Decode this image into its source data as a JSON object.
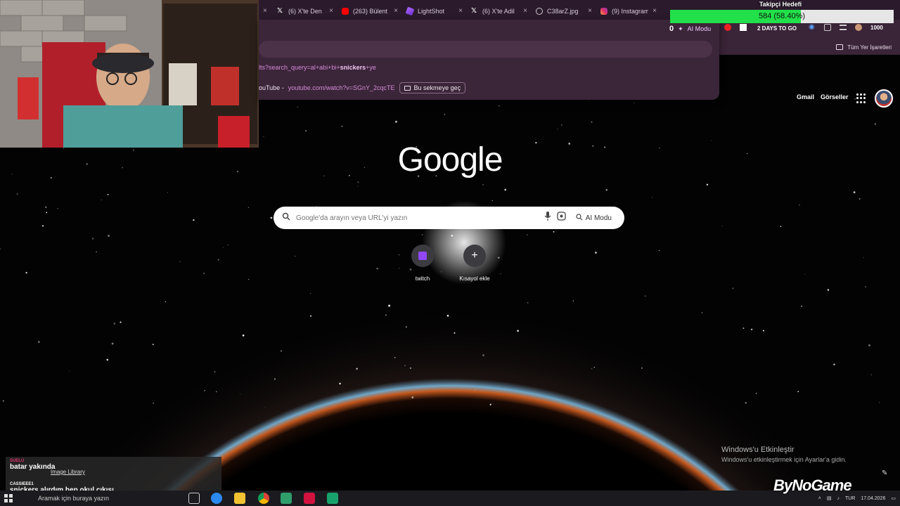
{
  "browser": {
    "tabs": [
      {
        "label": "(6) X'te Den",
        "icon": "x-icon"
      },
      {
        "label": "(263) Bülent",
        "icon": "youtube-icon"
      },
      {
        "label": "LightShot",
        "icon": "lightshot-icon"
      },
      {
        "label": "(6) X'te Adil",
        "icon": "x-icon"
      },
      {
        "label": "C38arZ.jpg",
        "icon": "globe-icon"
      },
      {
        "label": "(9) Instagram",
        "icon": "instagram-icon"
      }
    ],
    "omnibox": {
      "suggestion_search_prefix": "lts?search_query=al+abi+bi+",
      "suggestion_search_bold": "snickers",
      "suggestion_search_suffix": "+ye",
      "suggestion_site": "ouTube -",
      "suggestion_url": "youtube.com/watch?v=SGnY_2cqcTE",
      "switch_tab_label": "Bu sekmeye geç"
    },
    "bookmarks": {
      "all_bookmarks": "Tüm Yer İşaretleri"
    }
  },
  "overlay": {
    "goal_title": "Takipçi Hedefi",
    "goal_text": "584 (58.40%)",
    "goal_progress": 0.584,
    "counter_zero": "0",
    "ai_mode_chip": "AI Modu",
    "days_to_go": "2 DAYS TO GO",
    "count_right": "1000"
  },
  "google": {
    "logo": "Google",
    "gmail": "Gmail",
    "images": "Görseller",
    "search_placeholder": "Google'da arayın veya URL'yi yazın",
    "ai_mode": "AI Modu",
    "shortcuts": [
      {
        "label": "twitch"
      },
      {
        "label": "Kısayol ekle"
      }
    ]
  },
  "windows": {
    "activate_title": "Windows'u Etkinleştir",
    "activate_sub": "Windows'u etkinleştirmek için Ayarlar'a gidin.",
    "search_placeholder": "Aramak için buraya yazın",
    "tray_lang": "TUR",
    "tray_date": "17.04.2026"
  },
  "chat": {
    "messages": [
      {
        "user": "SUELU",
        "text": "batar yakında",
        "color": "#e0306a"
      },
      {
        "user": "CASSIEEE1",
        "text": "snickers alırdım hep okul çıkışı",
        "color": "#ffffff"
      }
    ],
    "library_link": "Image Library"
  },
  "watermark": "ByNoGame",
  "colors": {
    "tab_bg": "#2a1a2c",
    "toolbar_bg": "#3a2438",
    "goal_fill": "#22e04a",
    "accent_pink": "#d58cd8"
  }
}
